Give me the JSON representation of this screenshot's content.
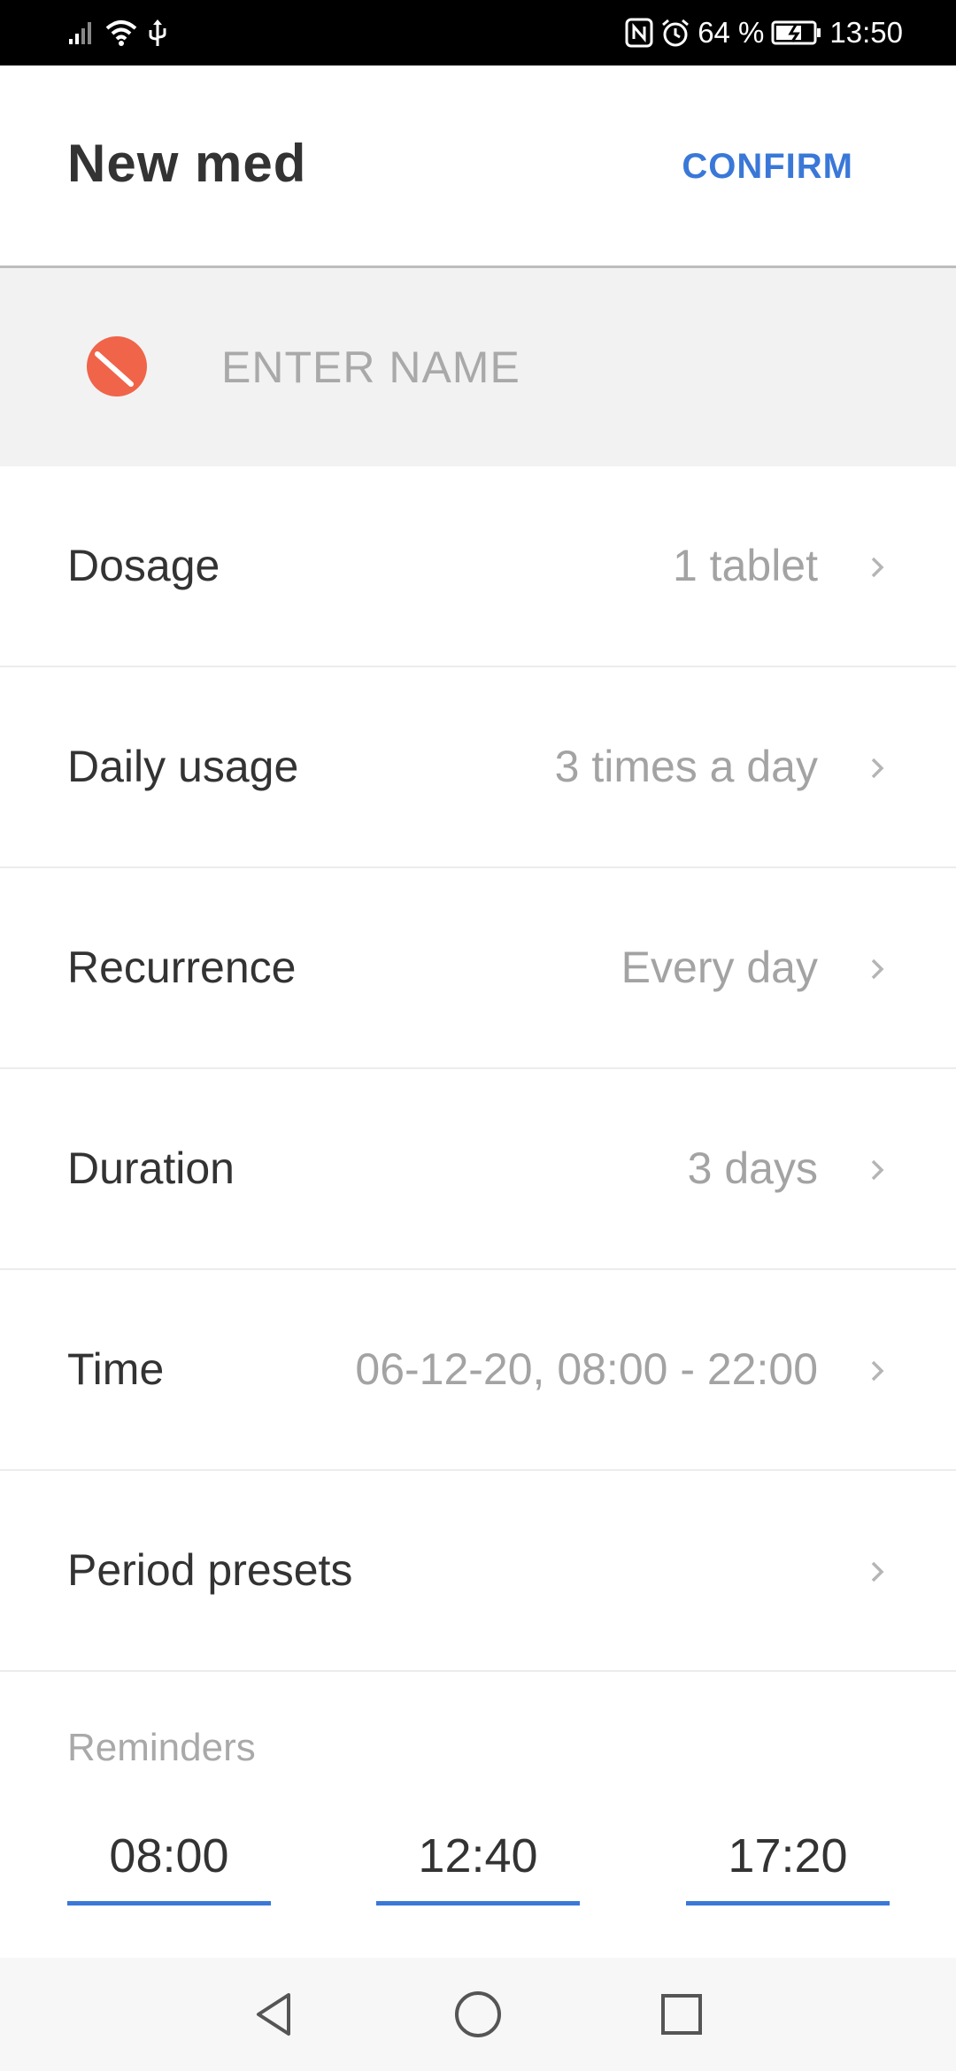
{
  "status_bar": {
    "battery": "64 %",
    "time": "13:50"
  },
  "header": {
    "title": "New med",
    "confirm_label": "CONFIRM"
  },
  "name_field": {
    "placeholder": "ENTER NAME",
    "value": ""
  },
  "settings": [
    {
      "label": "Dosage",
      "value": "1 tablet"
    },
    {
      "label": "Daily usage",
      "value": "3 times a day"
    },
    {
      "label": "Recurrence",
      "value": "Every day"
    },
    {
      "label": "Duration",
      "value": "3 days"
    },
    {
      "label": "Time",
      "value": "06-12-20, 08:00 - 22:00"
    },
    {
      "label": "Period presets",
      "value": ""
    }
  ],
  "reminders": {
    "heading": "Reminders",
    "times": [
      "08:00",
      "12:40",
      "17:20"
    ]
  },
  "colors": {
    "accent": "#3a78d8",
    "pill_icon": "#f06449",
    "label_text": "#333333",
    "value_text": "#a3a3a3"
  },
  "icons": {
    "pill": "pill-icon",
    "chevron": "chevron-right-icon",
    "nav_back": "back-triangle-icon",
    "nav_home": "home-circle-icon",
    "nav_recents": "recents-square-icon"
  }
}
